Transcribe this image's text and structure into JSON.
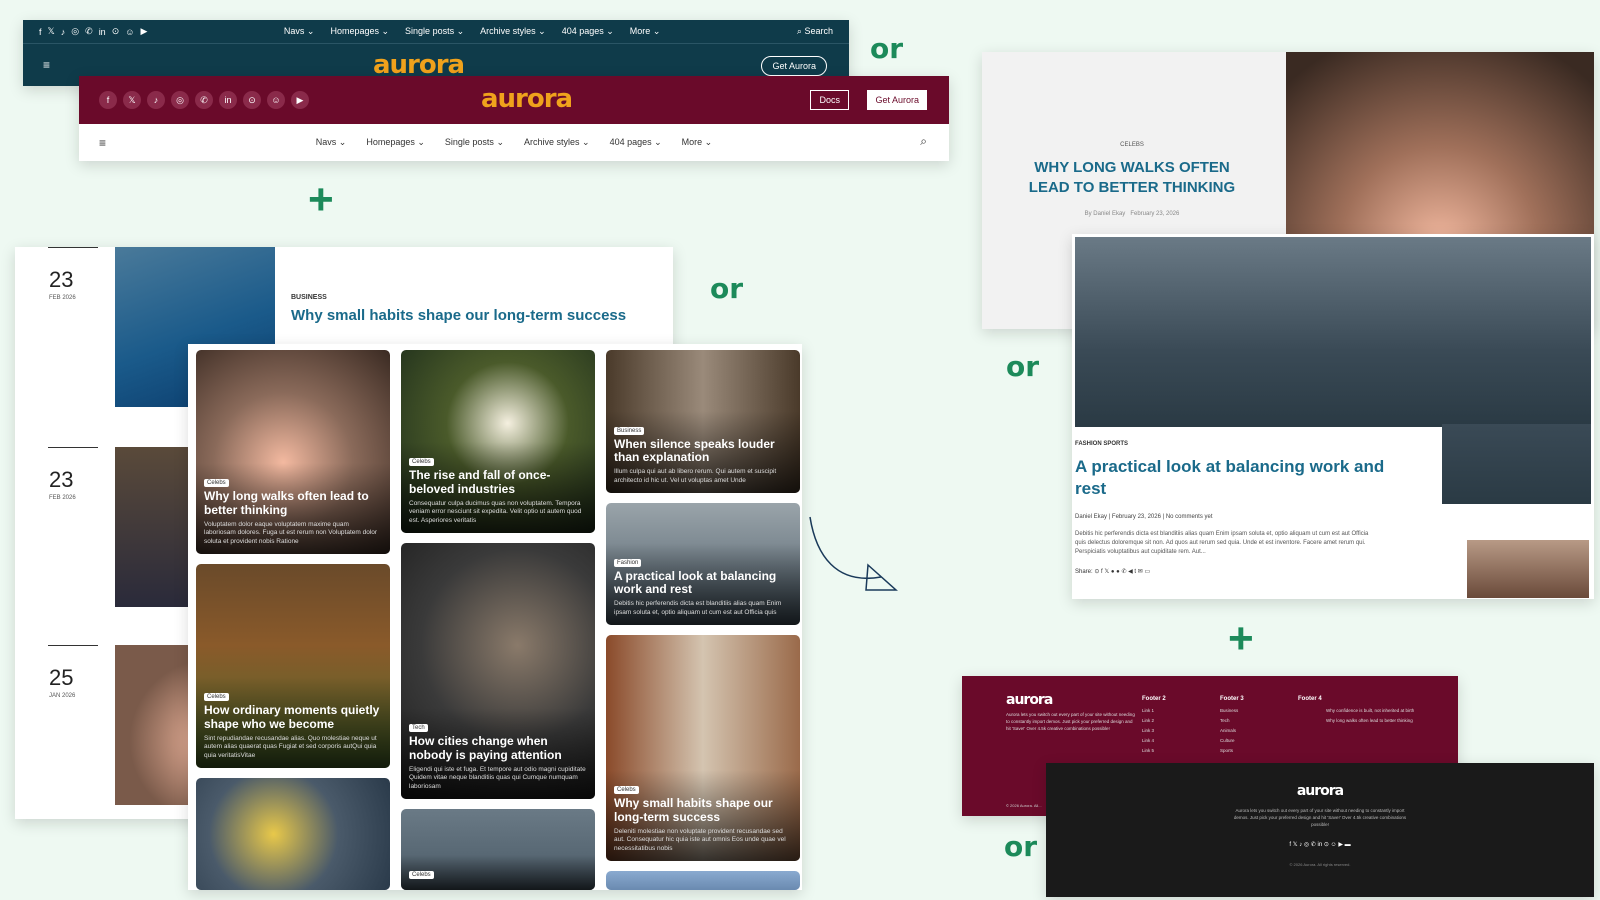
{
  "header1": {
    "social": [
      "f",
      "𝕏",
      "♪",
      "◎",
      "✆",
      "in",
      "⊙",
      "☺",
      "▶"
    ],
    "nav": [
      "Navs",
      "Homepages",
      "Single posts",
      "Archive styles",
      "404 pages",
      "More"
    ],
    "search": "Search",
    "logo": "aurora",
    "cta": "Get Aurora"
  },
  "header2": {
    "social": [
      "f",
      "𝕏",
      "♪",
      "◎",
      "✆",
      "in",
      "⊙",
      "☺",
      "▶"
    ],
    "logo": "aurora",
    "docs": "Docs",
    "cta": "Get Aurora",
    "nav": [
      "Navs",
      "Homepages",
      "Single posts",
      "Archive styles",
      "404 pages",
      "More"
    ]
  },
  "connectors": {
    "or": "or",
    "plus": "+"
  },
  "list": {
    "rows": [
      {
        "day": "23",
        "month": "FEB 2026"
      },
      {
        "day": "23",
        "month": "FEB 2026"
      },
      {
        "day": "25",
        "month": "JAN 2026"
      }
    ],
    "featured": {
      "category": "BUSINESS",
      "title": "Why small habits shape our long-term success"
    }
  },
  "grid": {
    "cards": [
      {
        "badge": "Celebs",
        "title": "Why long walks often lead to better thinking",
        "excerpt": "Voluptatem dolor eaque voluptatem maxime quam laboriosam dolores. Fuga ut est rerum non Voluptatem dolor soluta et provident nobis Ratione"
      },
      {
        "badge": "Celebs",
        "title": "The rise and fall of once-beloved industries",
        "excerpt": "Consequatur culpa ducimus quas non voluptatem. Tempora veniam error nesciunt sit expedita. Velit optio ut autem quod est. Asperiores veritatis"
      },
      {
        "badge": "Business",
        "title": "When silence speaks louder than explanation",
        "excerpt": "Illum culpa qui aut ab libero rerum. Qui autem et suscipit architecto id hic ut. Vel ut voluptas amet Unde"
      },
      {
        "badge": "Fashion",
        "title": "A practical look at balancing work and rest",
        "excerpt": "Debitis hic perferendis dicta est blanditiis alias quam Enim ipsam soluta et, optio aliquam ut cum est aut Officia quis"
      },
      {
        "badge": "Celebs",
        "title": "How ordinary moments quietly shape who we become",
        "excerpt": "Sint repudiandae recusandae alias. Quo molestiae neque ut autem alias quaerat quas Fugiat et sed corporis autQui quia quia veritatisVitae"
      },
      {
        "badge": "Tech",
        "title": "How cities change when nobody is paying attention",
        "excerpt": "Eligendi qui iste et fuga. Et tempore aut odio magni cupiditate Quidem vitae neque blanditiis quas qui Cumque numquam laboriosam"
      },
      {
        "badge": "Celebs",
        "title": "Why small habits shape our long-term success",
        "excerpt": "Deleniti molestiae non voluptate provident recusandae sed aut. Consequatur hic quia iste aut omnis Eos unde quae vel necessitatibus nobis"
      },
      {
        "badge": "Celebs",
        "title": "",
        "excerpt": ""
      },
      {
        "badge": "",
        "title": "",
        "excerpt": ""
      }
    ]
  },
  "article1": {
    "category": "CELEBS",
    "title": "WHY LONG WALKS OFTEN LEAD TO BETTER THINKING",
    "author": "By Daniel Ekay",
    "date": "February 23, 2026"
  },
  "article2": {
    "categories": "FASHION   SPORTS",
    "title": "A practical look at balancing work and rest",
    "meta": "Daniel Ekay  |  February 23, 2026  |  No comments yet",
    "excerpt": "Debitis hic perferendis dicta est blanditiis alias quam Enim ipsam soluta et, optio aliquam ut cum est aut Officia quis delectus doloremque sit non. Ad quos aut rerum sed quia. Unde et est inventore. Facere amet rerum qui. Perspiciatis voluptatibus aut cupiditate rem. Aut...",
    "share": "Share:  ⊙ f 𝕏 ● ● ✆ ◀ t ✉ ▭"
  },
  "footer1": {
    "logo": "aurora",
    "desc": "Aurora lets you switch out every part of your site without needing to constantly import demos. Just pick your preferred design and hit 'Save!' Over 4.5k creative combinations possible!",
    "col2": {
      "title": "Footer 2",
      "items": [
        "Link 1",
        "Link 2",
        "Link 3",
        "Link 4",
        "Link 5"
      ]
    },
    "col3": {
      "title": "Footer 3",
      "items": [
        "Business",
        "Tech",
        "Animals",
        "Culture",
        "Sports"
      ]
    },
    "col4": {
      "title": "Footer 4",
      "items": [
        "Why confidence is built, not inherited at birth",
        "Why long walks often lead to better thinking"
      ]
    },
    "copy": "© 2026 Aurora. All..."
  },
  "footer2": {
    "logo": "aurora",
    "desc": "Aurora lets you switch out every part of your site without needing to constantly import demos. Just pick your preferred design and hit 'Save!' Over 4.5k creative combinations possible!",
    "social": "f  𝕏  ♪  ◎  ✆  in  ⊙  ☺  ▶  ▬",
    "copy": "© 2026 Aurora. All rights reserved."
  },
  "colors": {
    "accent": "#1c8a5a",
    "maroon": "#6a0a2a",
    "teal": "#0f3b4a",
    "logo": "#f0a21c"
  }
}
